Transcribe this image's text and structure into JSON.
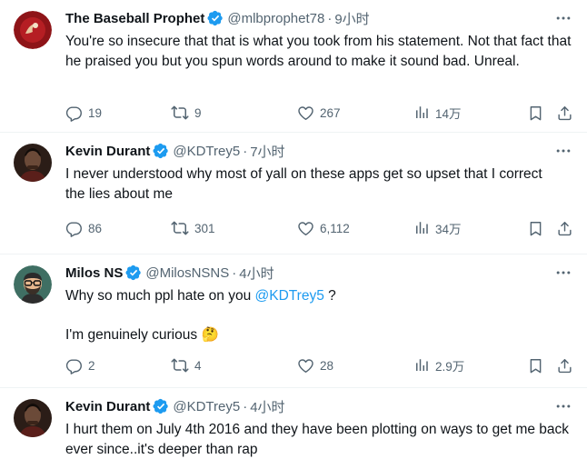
{
  "tweets": [
    {
      "name": "The Baseball Prophet",
      "handle": "@mlbprophet78",
      "time": "9小时",
      "text": "You're so insecure that that is what you took from his statement. Not that fact that he praised you but you spun words around to make it sound bad. Unreal.",
      "replies": "19",
      "retweets": "9",
      "likes": "267",
      "views": "14万"
    },
    {
      "name": "Kevin Durant",
      "handle": "@KDTrey5",
      "time": "7小时",
      "text": "I never understood why most of yall on these apps get so upset that I correct the lies about me",
      "replies": "86",
      "retweets": "301",
      "likes": "6,112",
      "views": "34万"
    },
    {
      "name": "Milos NS",
      "handle": "@MilosNSNS",
      "time": "4小时",
      "text_before_mention": "Why so much ppl hate on you ",
      "mention": "@KDTrey5",
      "text_after_mention": " ?",
      "text_line2": "I'm genuinely curious",
      "emoji": "🤔",
      "replies": "2",
      "retweets": "4",
      "likes": "28",
      "views": "2.9万"
    },
    {
      "name": "Kevin Durant",
      "handle": "@KDTrey5",
      "time": "4小时",
      "text": "I hurt them on July 4th 2016 and they have been plotting on ways to get me back ever since..it's deeper than rap"
    }
  ],
  "separator": "·",
  "icons": {
    "verified": "verified-badge-icon",
    "more": "more-options-icon",
    "reply": "reply-icon",
    "retweet": "retweet-icon",
    "like": "like-heart-icon",
    "views": "views-analytics-icon",
    "bookmark": "bookmark-icon",
    "share": "share-icon"
  },
  "colors": {
    "text": "#0f1419",
    "secondary": "#536471",
    "link": "#1d9bf0",
    "verified": "#1d9bf0",
    "divider": "#eff3f4"
  }
}
